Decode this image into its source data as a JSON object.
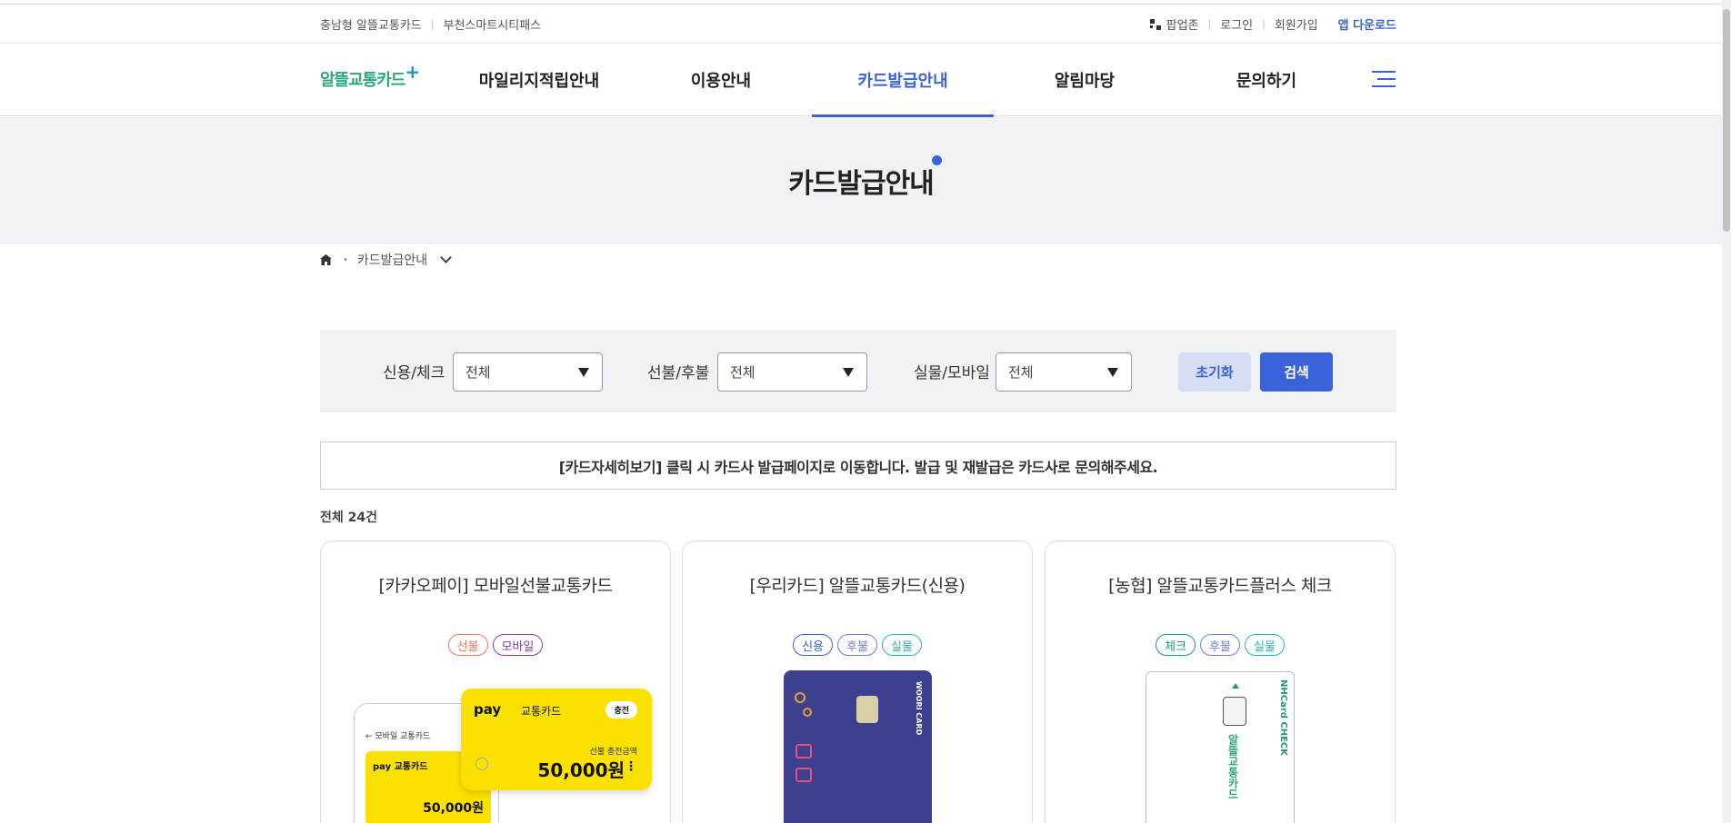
{
  "util_bar": {
    "left_links": [
      "충남형 알뜰교통카드",
      "부천스마트시티패스"
    ],
    "right_links": [
      {
        "label": "팝업존",
        "icon": "popup-grid-icon"
      },
      {
        "label": "로그인"
      },
      {
        "label": "회원가입"
      }
    ],
    "app_download": "앱 다운로드",
    "separator": "|"
  },
  "gnb": {
    "logo_text": "알뜰교통카드",
    "logo_plus": "+",
    "menu": [
      "마일리지적립안내",
      "이용안내",
      "카드발급안내",
      "알림마당",
      "문의하기"
    ],
    "active_index": 2,
    "menu_icon": "hamburger-menu-icon"
  },
  "hero": {
    "title": "카드발급안내"
  },
  "breadcrumb": {
    "home_icon": "home-icon",
    "current": "카드발급안내",
    "dropdown_icon": "chevron-down-icon"
  },
  "filter": {
    "credit_check": {
      "label": "신용/체크",
      "value": "전체"
    },
    "prepay_postpay": {
      "label": "선불/후불",
      "value": "전체"
    },
    "physical_mobile": {
      "label": "실물/모바일",
      "value": "전체"
    },
    "reset_label": "초기화",
    "search_label": "검색"
  },
  "notice": "[카드자세히보기] 클릭 시 카드사 발급페이지로 이동합니다. 발급 및 재발급은 카드사로 문의해주세요.",
  "total": "전체 24건",
  "cards": [
    {
      "title": "[카카오페이] 모바일선불교통카드",
      "tags": [
        {
          "label": "선불",
          "color": "#f0795a"
        },
        {
          "label": "모바일",
          "color": "#8a3fb0"
        }
      ],
      "image": {
        "phone_header": "← 모바일 교통카드",
        "phone_pay": "pay 교통카드",
        "phone_amount": "50,000원",
        "pay": "pay",
        "card_name": "교통카드",
        "charge": "충전",
        "sub": "선불 충전금액",
        "amount": "50,000원"
      }
    },
    {
      "title": "[우리카드] 알뜰교통카드(신용)",
      "tags": [
        {
          "label": "신용",
          "color": "#3b63d9"
        },
        {
          "label": "후불",
          "color": "#6c7fe0"
        },
        {
          "label": "실물",
          "color": "#2bb3b0"
        }
      ],
      "image": {
        "brand": "WOORI CARD"
      }
    },
    {
      "title": "[농협] 알뜰교통카드플러스 체크",
      "tags": [
        {
          "label": "체크",
          "color": "#1e9b6f"
        },
        {
          "label": "후불",
          "color": "#6c7fe0"
        },
        {
          "label": "실물",
          "color": "#2bb3b0"
        }
      ],
      "image": {
        "brand": "NHCard CHECK",
        "vertical_logo": "알뜰교통카드"
      }
    }
  ]
}
